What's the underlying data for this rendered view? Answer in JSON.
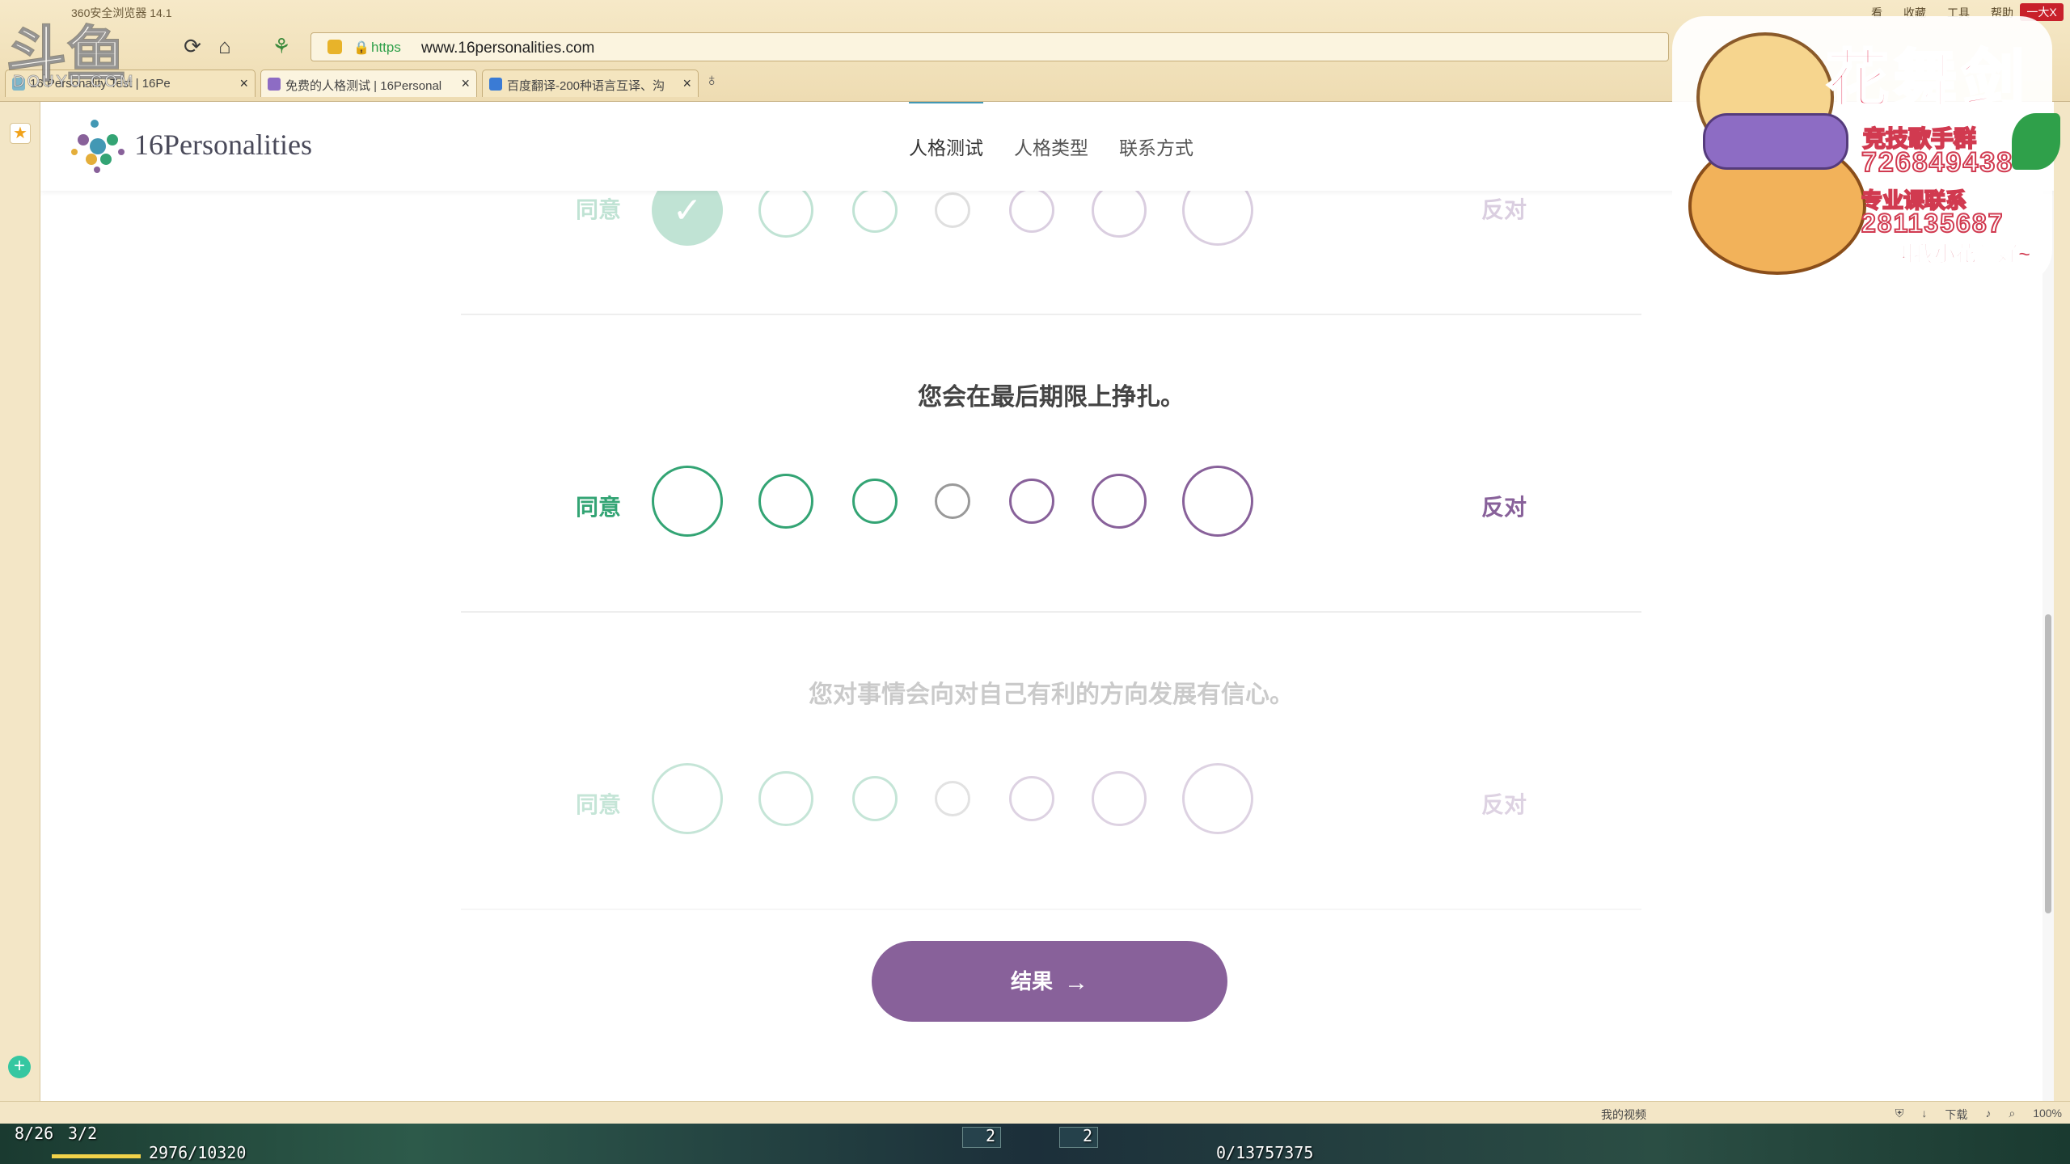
{
  "browser": {
    "name": "360安全浏览器 14.1",
    "menu": [
      "看",
      "收藏",
      "工具",
      "帮助"
    ],
    "close_label": "一大X",
    "address": {
      "https": "https",
      "url": "www.16personalities.com"
    },
    "tabs": [
      {
        "title": "16 Personality Test | 16Pe",
        "active": false
      },
      {
        "title": "免费的人格测试 | 16Personal",
        "active": true
      },
      {
        "title": "百度翻译-200种语言互译、沟",
        "active": false
      }
    ]
  },
  "watermark": {
    "mark": "斗鱼",
    "text": "DOUYU.COM"
  },
  "site": {
    "brand": "16Personalities",
    "nav": [
      "人格测试",
      "人格类型",
      "联系方式"
    ],
    "active_nav": 0
  },
  "questions": [
    {
      "text": "",
      "agree": "同意",
      "disagree": "反对",
      "state": "answered",
      "selected": 0
    },
    {
      "text": "您会在最后期限上挣扎。",
      "agree": "同意",
      "disagree": "反对",
      "state": "active",
      "selected": null
    },
    {
      "text": "您对事情会向对自己有利的方向发展有信心。",
      "agree": "同意",
      "disagree": "反对",
      "state": "inactive",
      "selected": null
    }
  ],
  "result_button": {
    "label": "结果",
    "arrow": "→"
  },
  "colors": {
    "agree": "#33a474",
    "neutral": "#999999",
    "disagree": "#88619a",
    "button": "#88619a",
    "nav_active": "#4298b4"
  },
  "sticker": {
    "title": "花舞剑",
    "line1": "竞技歌手群",
    "line2": "726849438",
    "line3": "专业课联系",
    "line4": "281135687",
    "line5": "叫我小花就好~"
  },
  "statusbar": {
    "video": "我的视频",
    "download": "下载",
    "zoom": "100%"
  },
  "game_hud": {
    "left1": "8/26",
    "left2": "3/2",
    "exp": "2976/10320",
    "center": "0/13757375",
    "slot_a": "2",
    "slot_b": "2"
  }
}
